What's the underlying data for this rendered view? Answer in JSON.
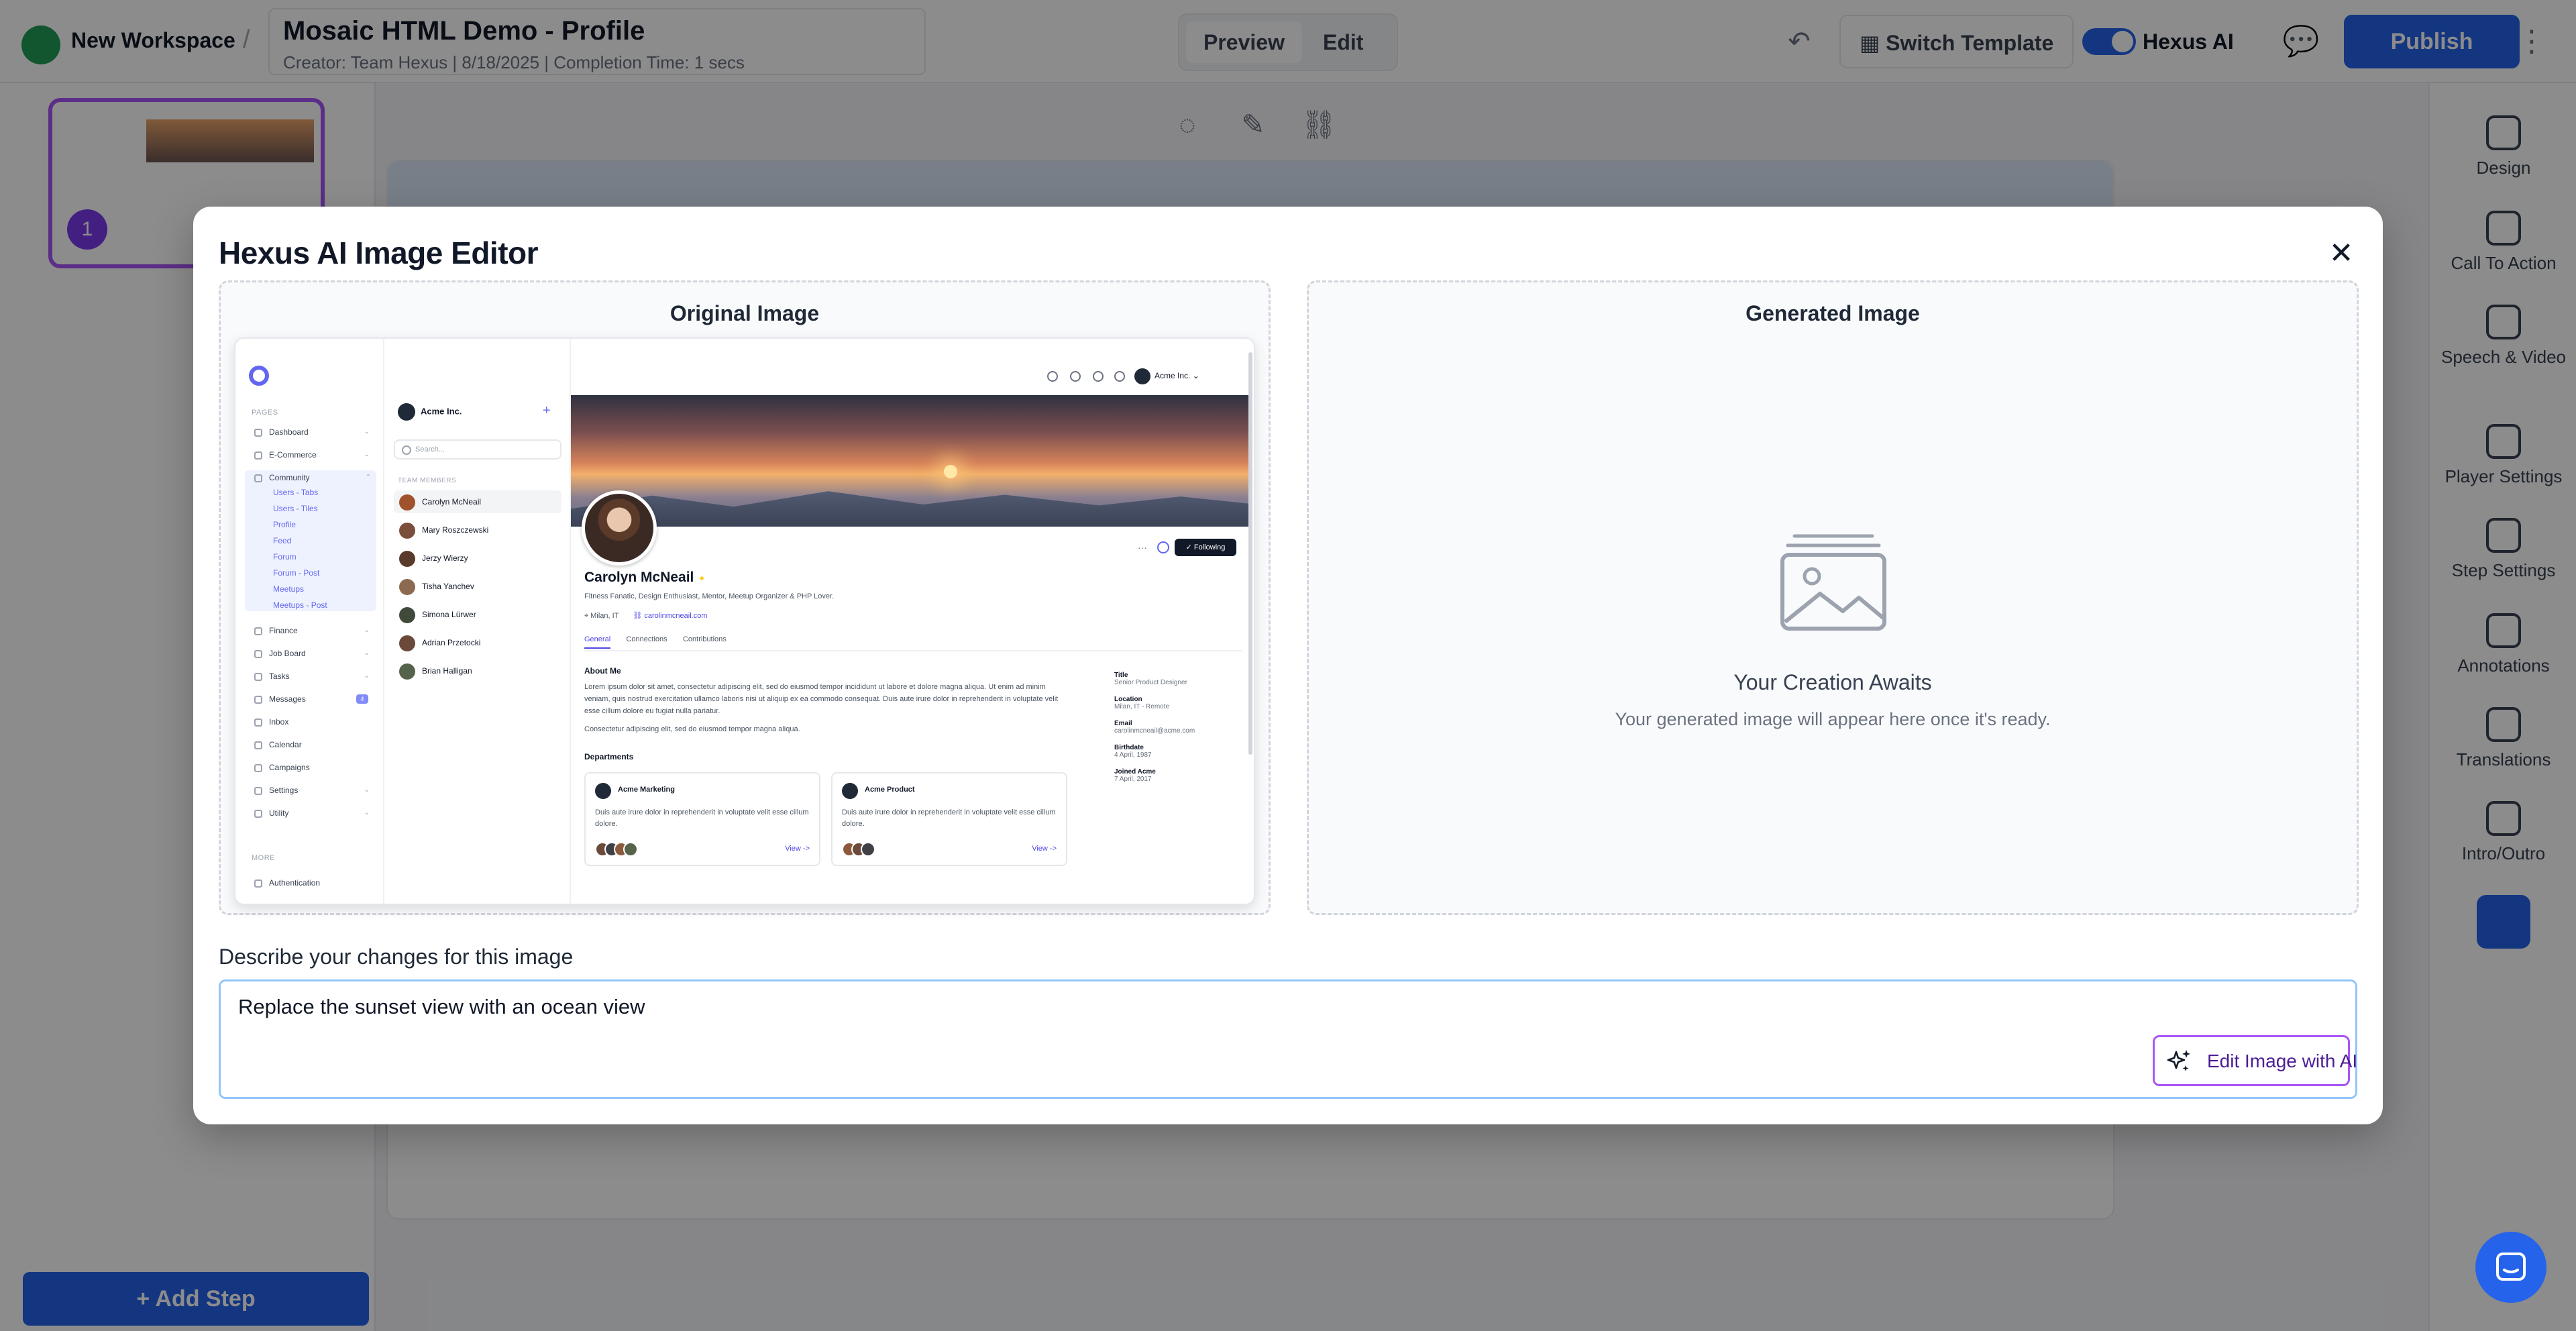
{
  "topbar": {
    "workspace": "New Workspace",
    "separator": "/",
    "doc_title": "Mosaic HTML Demo - Profile",
    "doc_subtitle": "Creator: Team Hexus | 8/18/2025 | Completion Time: 1 secs",
    "preview_label": "Preview",
    "edit_label": "Edit",
    "switch_template_label": "Switch Template",
    "hexus_ai_label": "Hexus AI",
    "publish_label": "Publish"
  },
  "left_panel": {
    "step_badge": "1",
    "add_step_label": "+ Add Step"
  },
  "right_rail": {
    "items": [
      {
        "label": "Design"
      },
      {
        "label": "Call To Action"
      },
      {
        "label": "Speech & Video"
      },
      {
        "label": "Player Settings"
      },
      {
        "label": "Step Settings"
      },
      {
        "label": "Annotations"
      },
      {
        "label": "Translations"
      },
      {
        "label": "Intro/Outro"
      }
    ]
  },
  "modal": {
    "title": "Hexus AI Image Editor",
    "close_glyph": "✕",
    "original_heading": "Original Image",
    "generated_heading": "Generated Image",
    "placeholder_title": "Your Creation Awaits",
    "placeholder_subtitle": "Your generated image will appear here once it's ready.",
    "prompt_label": "Describe your changes for this image",
    "prompt_value": "Replace the sunset view with an ocean view",
    "edit_button_label": "Edit Image with AI"
  },
  "original_image": {
    "nav": {
      "pages_label": "PAGES",
      "more_label": "MORE",
      "items": [
        {
          "label": "Dashboard"
        },
        {
          "label": "E-Commerce"
        },
        {
          "label": "Community"
        },
        {
          "label": "Finance"
        },
        {
          "label": "Job Board"
        },
        {
          "label": "Tasks"
        },
        {
          "label": "Messages",
          "badge": "4"
        },
        {
          "label": "Inbox"
        },
        {
          "label": "Calendar"
        },
        {
          "label": "Campaigns"
        },
        {
          "label": "Settings"
        },
        {
          "label": "Utility"
        },
        {
          "label": "Authentication"
        }
      ],
      "community_subitems": [
        "Users - Tabs",
        "Users - Tiles",
        "Profile",
        "Feed",
        "Forum",
        "Forum - Post",
        "Meetups",
        "Meetups - Post"
      ]
    },
    "team": {
      "name": "Acme Inc.",
      "search_placeholder": "Search...",
      "members_label": "TEAM MEMBERS",
      "members": [
        "Carolyn McNeail",
        "Mary Roszczewski",
        "Jerzy Wierzy",
        "Tisha Yanchev",
        "Simona Lürwer",
        "Adrian Przetocki",
        "Brian Halligan"
      ]
    },
    "account_label": "Acme Inc.",
    "profile": {
      "follow_label": "Following",
      "name": "Carolyn McNeail",
      "bio": "Fitness Fanatic, Design Enthusiast, Mentor, Meetup Organizer & PHP Lover.",
      "location": "Milan, IT",
      "website": "carolinmcneail.com",
      "tabs": [
        "General",
        "Connections",
        "Contributions"
      ],
      "about_heading": "About Me",
      "about_text": "Lorem ipsum dolor sit amet, consectetur adipiscing elit, sed do eiusmod tempor incididunt ut labore et dolore magna aliqua. Ut enim ad minim veniam, quis nostrud exercitation ullamco laboris nisi ut aliquip ex ea commodo consequat. Duis aute irure dolor in reprehenderit in voluptate velit esse cillum dolore eu fugiat nulla pariatur.",
      "about_text_2": "Consectetur adipiscing elit, sed do eiusmod tempor magna aliqua.",
      "departments_heading": "Departments",
      "departments": [
        {
          "name": "Acme Marketing",
          "text": "Duis aute irure dolor in reprehenderit in voluptate velit esse cillum dolore.",
          "link": "View ->"
        },
        {
          "name": "Acme Product",
          "text": "Duis aute irure dolor in reprehenderit in voluptate velit esse cillum dolore.",
          "link": "View ->"
        }
      ],
      "facts": [
        {
          "label": "Title",
          "value": "Senior Product Designer"
        },
        {
          "label": "Location",
          "value": "Milan, IT - Remote"
        },
        {
          "label": "Email",
          "value": "carolinmcneail@acme.com"
        },
        {
          "label": "Birthdate",
          "value": "4 April, 1987"
        },
        {
          "label": "Joined Acme",
          "value": "7 April, 2017"
        }
      ]
    }
  }
}
